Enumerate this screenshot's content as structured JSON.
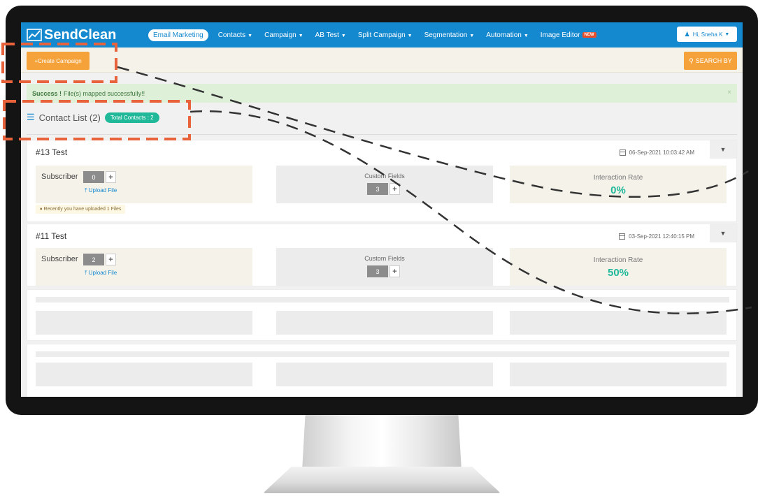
{
  "app": {
    "name": "SendClean",
    "brand_color": "#1589cf",
    "accent_color": "#f6a23a",
    "success_color": "#1fb99a"
  },
  "nav": {
    "items": [
      {
        "label": "Email Marketing",
        "active": true,
        "dropdown": false
      },
      {
        "label": "Contacts",
        "dropdown": true
      },
      {
        "label": "Campaign",
        "dropdown": true
      },
      {
        "label": "AB Test",
        "dropdown": true
      },
      {
        "label": "Split Campaign",
        "dropdown": true
      },
      {
        "label": "Segmentation",
        "dropdown": true
      },
      {
        "label": "Automation",
        "dropdown": true
      },
      {
        "label": "Image Editor",
        "badge": "NEW"
      }
    ],
    "user_label": "Hi, Sneha K",
    "user_icon": "user-icon"
  },
  "toolbar": {
    "create_label": "+Create Campaign",
    "search_label": "SEARCH BY",
    "search_icon": "search-icon"
  },
  "alert": {
    "strong": "Success !",
    "message": "File(s) mapped successfully!!",
    "close": "×"
  },
  "heading": {
    "title": "Contact List (2)",
    "badge": "Total Contacts : 2",
    "icon": "list-icon"
  },
  "lists": [
    {
      "name": "#13 Test",
      "date": "06-Sep-2021 10:03:42 AM",
      "subscriber_label": "Subscriber",
      "subscriber_count": "0",
      "upload_label": "Upload File",
      "custom_fields_label": "Custom Fields",
      "custom_fields_count": "3",
      "interaction_label": "Interaction Rate",
      "interaction_rate": "0%",
      "notice": "Recently you have uploaded 1 Files"
    },
    {
      "name": "#11 Test",
      "date": "03-Sep-2021 12:40:15 PM",
      "subscriber_label": "Subscriber",
      "subscriber_count": "2",
      "upload_label": "Upload File",
      "custom_fields_label": "Custom Fields",
      "custom_fields_count": "3",
      "interaction_label": "Interaction Rate",
      "interaction_rate": "50%"
    }
  ],
  "overlay": {
    "highlight_color": "#e8623b",
    "dash_color": "#333333"
  }
}
